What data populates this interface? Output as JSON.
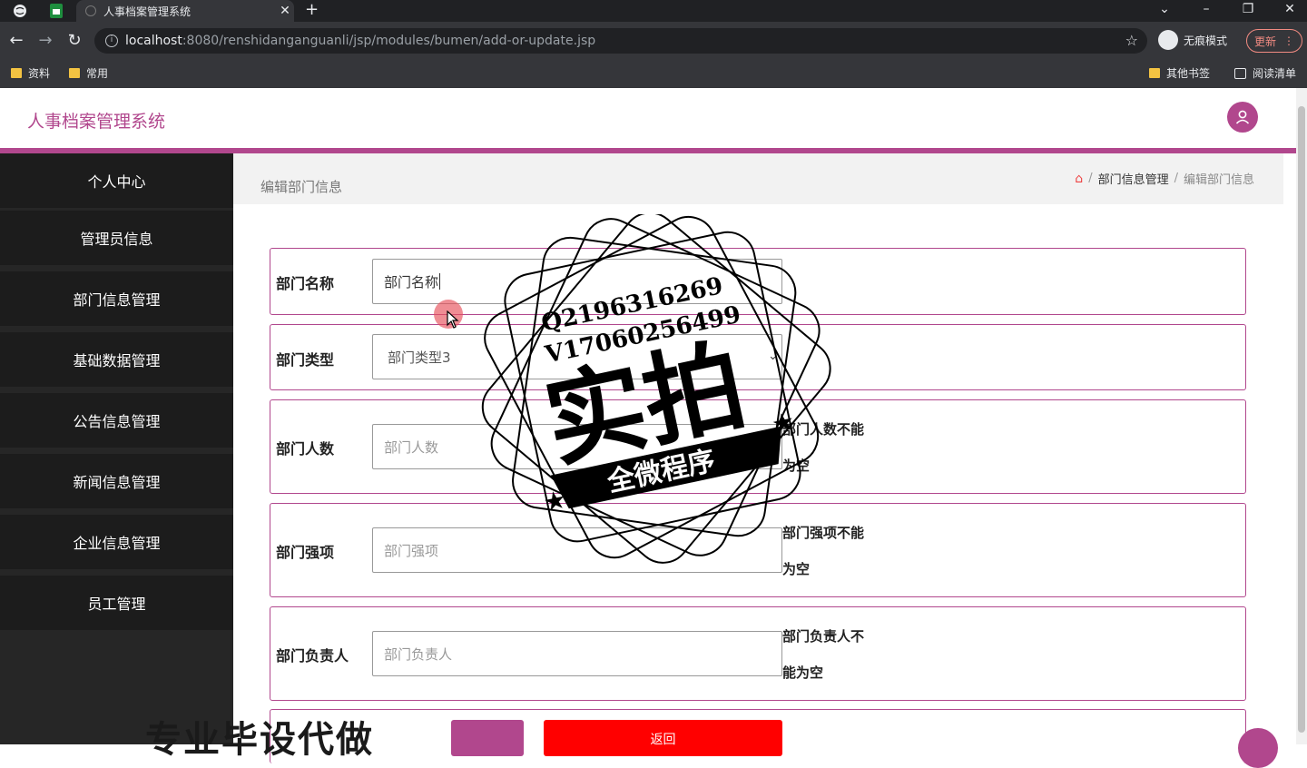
{
  "browser": {
    "tab_title": "人事档案管理系统",
    "url_host": "localhost",
    "url_path": ":8080/renshidanganguanli/jsp/modules/bumen/add-or-update.jsp",
    "profile_label": "无痕模式",
    "update_label": "更新",
    "bookmarks": [
      "资料",
      "常用",
      "其他书签",
      "阅读清单"
    ]
  },
  "app": {
    "title": "人事档案管理系统",
    "accent_color": "#b1478d"
  },
  "sidebar": {
    "items": [
      "个人中心",
      "管理员信息",
      "部门信息管理",
      "基础数据管理",
      "公告信息管理",
      "新闻信息管理",
      "企业信息管理",
      "员工管理"
    ]
  },
  "page": {
    "heading": "编辑部门信息",
    "breadcrumb_section": "部门信息管理",
    "breadcrumb_current": "编辑部门信息"
  },
  "form": {
    "name_label": "部门名称",
    "name_value": "部门名称",
    "type_label": "部门类型",
    "type_selected": "部门类型3",
    "count_label": "部门人数",
    "count_placeholder": "部门人数",
    "count_error_1": "部门人数不能",
    "count_error_2": "为空",
    "strength_label": "部门强项",
    "strength_placeholder": "部门强项",
    "strength_error_1": "部门强项不能",
    "strength_error_2": "为空",
    "leader_label": "部门负责人",
    "leader_placeholder": "部门负责人",
    "leader_error_1": "部门负责人不",
    "leader_error_2": "能为空",
    "back_label": "返回"
  },
  "watermark": {
    "line1": "Q2196316269",
    "line2": "V17060256499",
    "big": "实拍",
    "banner": "全微程序",
    "bottom": "专业毕设代做"
  }
}
